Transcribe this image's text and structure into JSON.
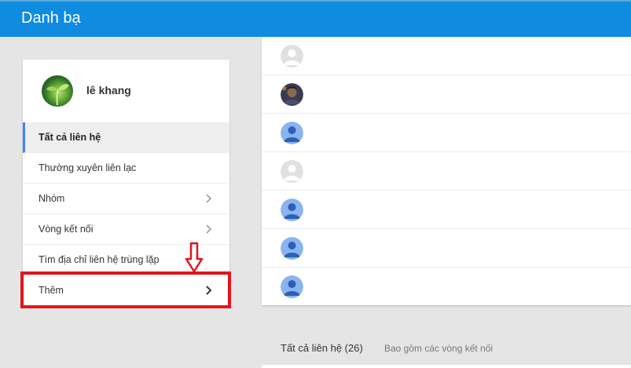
{
  "header": {
    "title": "Danh bạ"
  },
  "profile": {
    "name": "lê khang",
    "avatar_icon": "plant-sprout-photo"
  },
  "nav": {
    "items": [
      {
        "label": "Tất cả liên hệ",
        "active": true,
        "has_chevron": false
      },
      {
        "label": "Thường xuyên liên lạc",
        "active": false,
        "has_chevron": false
      },
      {
        "label": "Nhóm",
        "active": false,
        "has_chevron": true
      },
      {
        "label": "Vòng kết nối",
        "active": false,
        "has_chevron": true
      },
      {
        "label": "Tìm địa chỉ liên hệ trùng lặp",
        "active": false,
        "has_chevron": false
      },
      {
        "label": "Thêm",
        "active": false,
        "has_chevron": true
      }
    ]
  },
  "annotation": {
    "highlight_color": "#e0161d",
    "arrow_icon": "down-arrow-icon"
  },
  "contacts": [
    {
      "avatar": "gray-person-icon"
    },
    {
      "avatar": "photo-avatar"
    },
    {
      "avatar": "blue-person-icon"
    },
    {
      "avatar": "gray-person-icon"
    },
    {
      "avatar": "blue-person-icon"
    },
    {
      "avatar": "blue-person-icon"
    },
    {
      "avatar": "blue-person-icon"
    }
  ],
  "footer": {
    "all_contacts": "Tất cả liên hệ (26)",
    "includes": "Bao gồm các vòng kết nối"
  },
  "colors": {
    "topbar": "#0f8be0",
    "accent": "#4285f4",
    "blue_avatar": "#7ba7e6",
    "gray_avatar": "#e0e0e0"
  }
}
